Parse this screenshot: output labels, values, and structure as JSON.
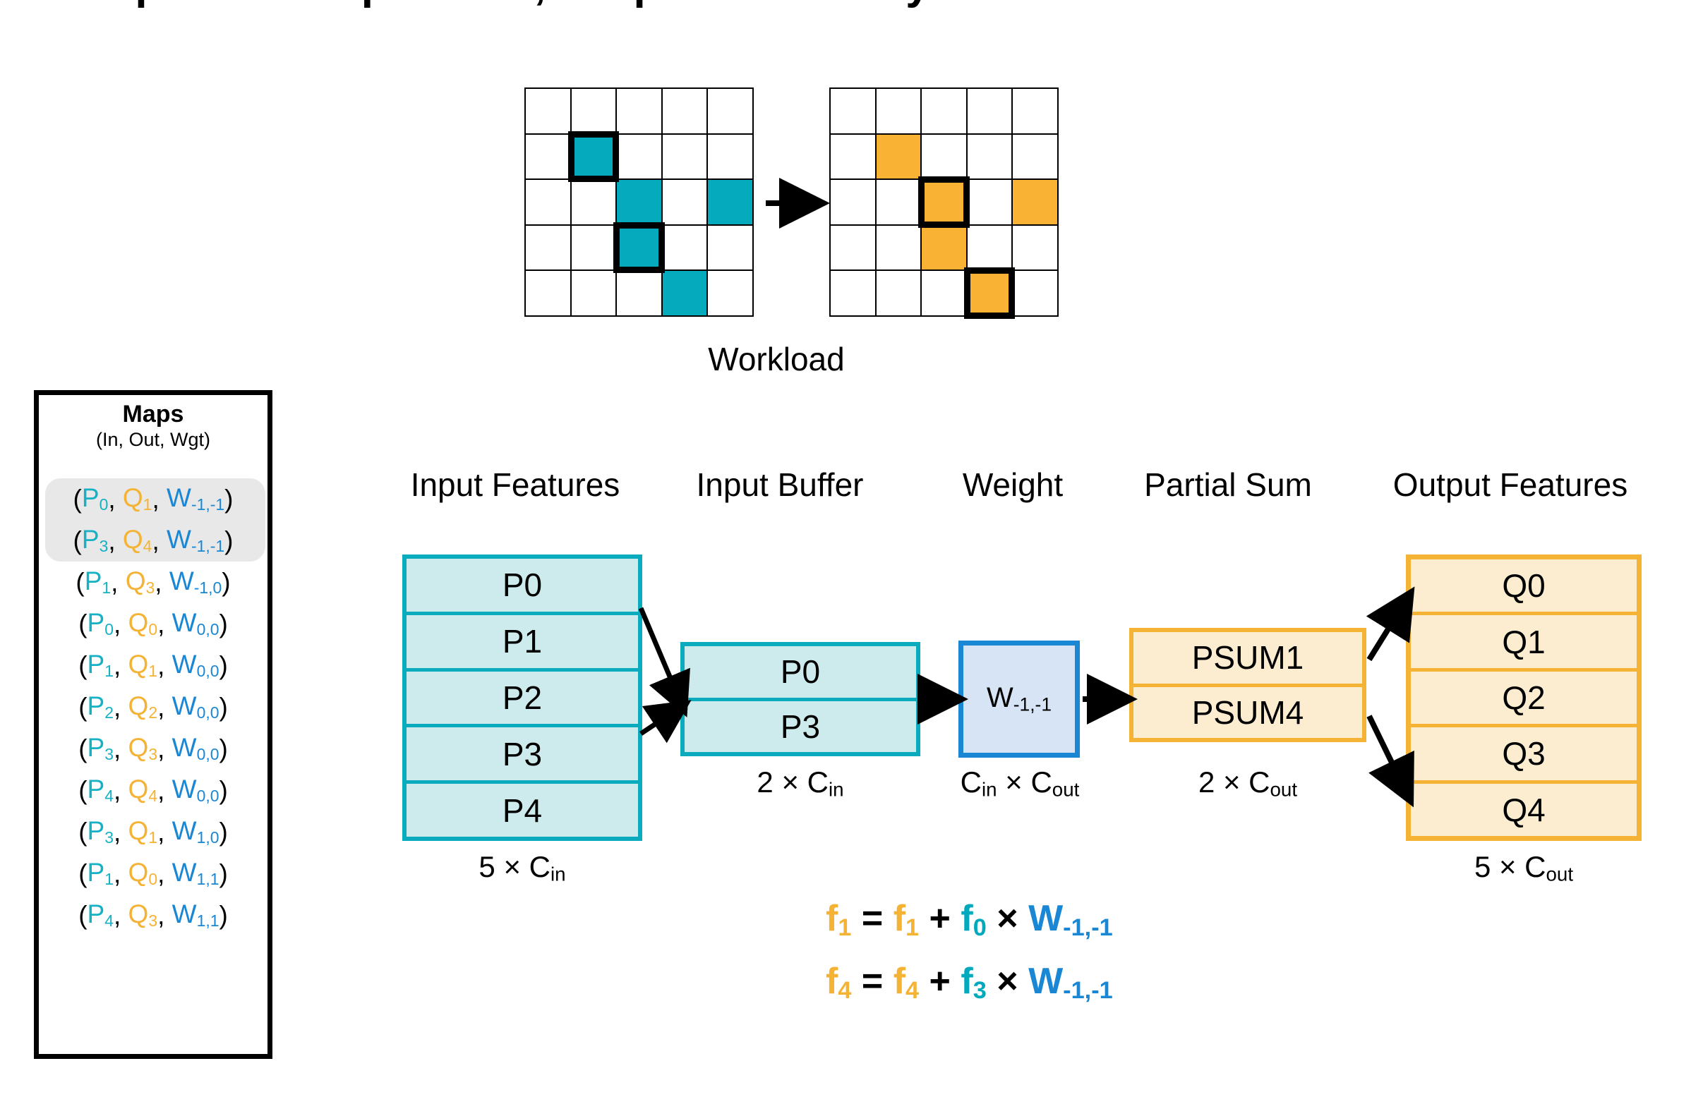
{
  "title_strip": "Sparse Computation, Output-Stationary Dataflow",
  "maps": {
    "title": "Maps",
    "subtitle": "(In, Out, Wgt)",
    "highlighted_count": 2,
    "rows": [
      {
        "in": "P",
        "in_sub": "0",
        "out": "Q",
        "out_sub": "1",
        "wgt": "W",
        "wgt_sub": "-1,-1",
        "highlighted": true
      },
      {
        "in": "P",
        "in_sub": "3",
        "out": "Q",
        "out_sub": "4",
        "wgt": "W",
        "wgt_sub": "-1,-1",
        "highlighted": true
      },
      {
        "in": "P",
        "in_sub": "1",
        "out": "Q",
        "out_sub": "3",
        "wgt": "W",
        "wgt_sub": "-1,0",
        "highlighted": false
      },
      {
        "in": "P",
        "in_sub": "0",
        "out": "Q",
        "out_sub": "0",
        "wgt": "W",
        "wgt_sub": "0,0",
        "highlighted": false
      },
      {
        "in": "P",
        "in_sub": "1",
        "out": "Q",
        "out_sub": "1",
        "wgt": "W",
        "wgt_sub": "0,0",
        "highlighted": false
      },
      {
        "in": "P",
        "in_sub": "2",
        "out": "Q",
        "out_sub": "2",
        "wgt": "W",
        "wgt_sub": "0,0",
        "highlighted": false
      },
      {
        "in": "P",
        "in_sub": "3",
        "out": "Q",
        "out_sub": "3",
        "wgt": "W",
        "wgt_sub": "0,0",
        "highlighted": false
      },
      {
        "in": "P",
        "in_sub": "4",
        "out": "Q",
        "out_sub": "4",
        "wgt": "W",
        "wgt_sub": "0,0",
        "highlighted": false
      },
      {
        "in": "P",
        "in_sub": "3",
        "out": "Q",
        "out_sub": "1",
        "wgt": "W",
        "wgt_sub": "1,0",
        "highlighted": false
      },
      {
        "in": "P",
        "in_sub": "1",
        "out": "Q",
        "out_sub": "0",
        "wgt": "W",
        "wgt_sub": "1,1",
        "highlighted": false
      },
      {
        "in": "P",
        "in_sub": "4",
        "out": "Q",
        "out_sub": "3",
        "wgt": "W",
        "wgt_sub": "1,1",
        "highlighted": false
      }
    ]
  },
  "workload": {
    "label": "Workload",
    "grid_rows": 5,
    "grid_cols": 5,
    "input_grid": {
      "fill_color": "#05abbd",
      "filled_cells": [
        [
          1,
          1
        ],
        [
          2,
          2
        ],
        [
          2,
          4
        ],
        [
          3,
          2
        ],
        [
          4,
          3
        ]
      ],
      "highlighted_cells": [
        [
          1,
          1
        ],
        [
          3,
          2
        ]
      ]
    },
    "output_grid": {
      "fill_color": "#f9b233",
      "filled_cells": [
        [
          1,
          1
        ],
        [
          2,
          2
        ],
        [
          2,
          4
        ],
        [
          3,
          2
        ],
        [
          4,
          3
        ]
      ],
      "highlighted_cells": [
        [
          2,
          2
        ],
        [
          4,
          3
        ]
      ]
    }
  },
  "dataflow": {
    "headers": {
      "input_features": "Input Features",
      "input_buffer": "Input Buffer",
      "weight": "Weight",
      "partial_sum": "Partial Sum",
      "output_features": "Output Features"
    },
    "input_features": {
      "slots": [
        "P0",
        "P1",
        "P2",
        "P3",
        "P4"
      ],
      "dim_count": "5",
      "dim_times": "×",
      "dim_channel": "C",
      "dim_channel_sub": "in",
      "accent": "#0aabbd",
      "fill": "#cdebec"
    },
    "input_buffer": {
      "slots": [
        "P0",
        "P3"
      ],
      "dim_count": "2",
      "dim_times": "×",
      "dim_channel": "C",
      "dim_channel_sub": "in",
      "accent": "#0aabbd",
      "fill": "#cdebec"
    },
    "weight": {
      "label": "W",
      "label_sub": "-1,-1",
      "dim_first": "C",
      "dim_first_sub": "in",
      "dim_times": "×",
      "dim_second": "C",
      "dim_second_sub": "out",
      "accent": "#1a87d4",
      "fill": "#d6e4f5"
    },
    "partial_sum": {
      "slots": [
        "PSUM1",
        "PSUM4"
      ],
      "dim_count": "2",
      "dim_times": "×",
      "dim_channel": "C",
      "dim_channel_sub": "out",
      "accent": "#f5b335",
      "fill": "#fcecd0"
    },
    "output_features": {
      "slots": [
        "Q0",
        "Q1",
        "Q2",
        "Q3",
        "Q4"
      ],
      "dim_count": "5",
      "dim_times": "×",
      "dim_channel": "C",
      "dim_channel_sub": "out",
      "accent": "#f5b335",
      "fill": "#fcecd0"
    }
  },
  "equations": [
    {
      "lhs": "f",
      "lhs_sub": "1",
      "eq": "=",
      "acc": "f",
      "acc_sub": "1",
      "plus": "+",
      "inp": "f",
      "inp_sub": "0",
      "times": "×",
      "wgt": "W",
      "wgt_sub": "-1,-1"
    },
    {
      "lhs": "f",
      "lhs_sub": "4",
      "eq": "=",
      "acc": "f",
      "acc_sub": "4",
      "plus": "+",
      "inp": "f",
      "inp_sub": "3",
      "times": "×",
      "wgt": "W",
      "wgt_sub": "-1,-1"
    }
  ],
  "colors": {
    "teal": "#05abbd",
    "orange": "#f9b233",
    "blue": "#1a87d4",
    "teal_fill": "#cdebec",
    "orange_fill": "#fcecd0",
    "blue_fill": "#d6e4f5",
    "highlight_band": "#e8e8e8",
    "black": "#000000"
  }
}
